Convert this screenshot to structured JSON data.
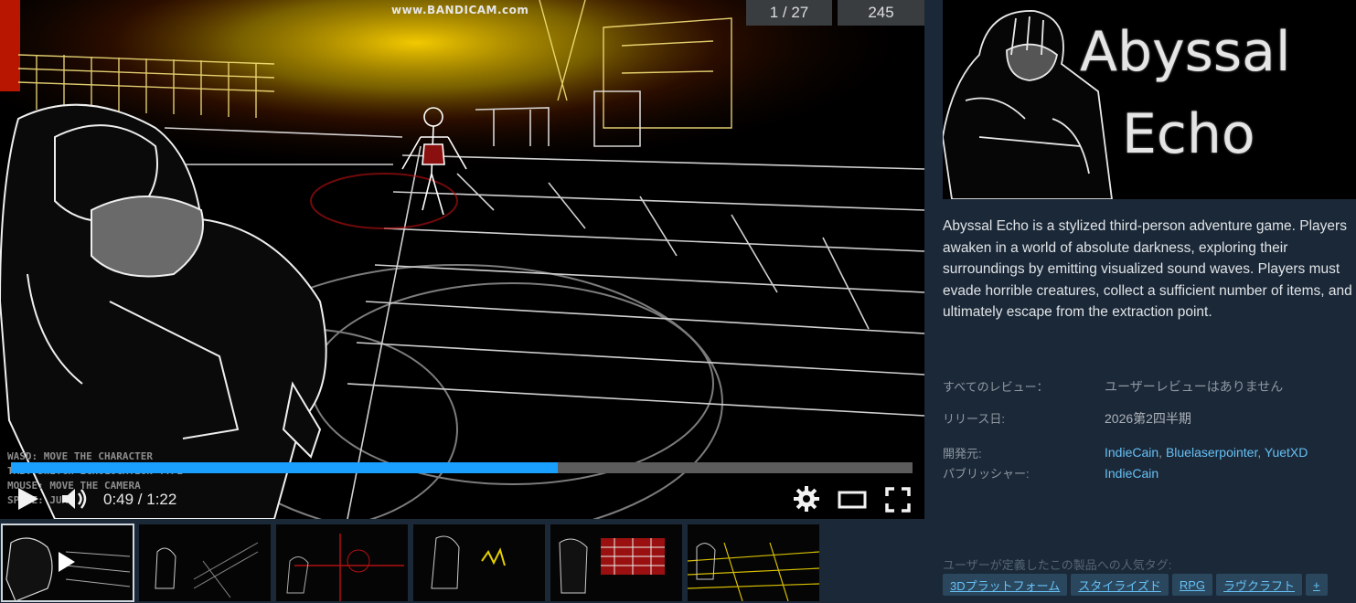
{
  "player": {
    "watermark": "www.BANDICAM.com",
    "screenshot_index": "1 / 27",
    "total": "245",
    "controls_hint": "WASD: MOVE THE CHARACTER\nTAB: SWITCH ECHOLOCATION TYPE\nMOUSE: MOVE THE CAMERA\nSPACE: JUMP",
    "progress_fraction": 0.606,
    "time": "0:49 / 1:22"
  },
  "thumbnails": [
    {
      "name": "thumb-1",
      "active": true
    },
    {
      "name": "thumb-2"
    },
    {
      "name": "thumb-3"
    },
    {
      "name": "thumb-4"
    },
    {
      "name": "thumb-5"
    },
    {
      "name": "thumb-6"
    }
  ],
  "capsule": {
    "title_line1": "Abyssal",
    "title_line2": "Echo"
  },
  "description": "Abyssal Echo is a stylized third-person adventure game. Players awaken in a world of absolute darkness, exploring their surroundings by emitting visualized sound waves. Players must evade horrible creatures, collect a sufficient number of items, and ultimately escape from the extraction point.",
  "reviews": {
    "label": "すべてのレビュー：",
    "value": "ユーザーレビューはありません"
  },
  "release": {
    "label": "リリース日:",
    "value": "2026第2四半期"
  },
  "developer": {
    "label": "開発元:",
    "names": [
      "IndieCain",
      "Bluelaserpointer",
      "YuetXD"
    ],
    "separator": ", "
  },
  "publisher": {
    "label": "パブリッシャー:",
    "name": "IndieCain"
  },
  "tags": {
    "heading": "ユーザーが定義したこの製品への人気タグ:",
    "items": [
      "3Dプラットフォーム",
      "スタイライズド",
      "RPG",
      "ラヴクラフト"
    ],
    "more": "+"
  },
  "colors": {
    "page_bg": "#1b2838",
    "link": "#66c0f4",
    "progress": "#1a9fff",
    "tag_bg": "#2a475e"
  }
}
